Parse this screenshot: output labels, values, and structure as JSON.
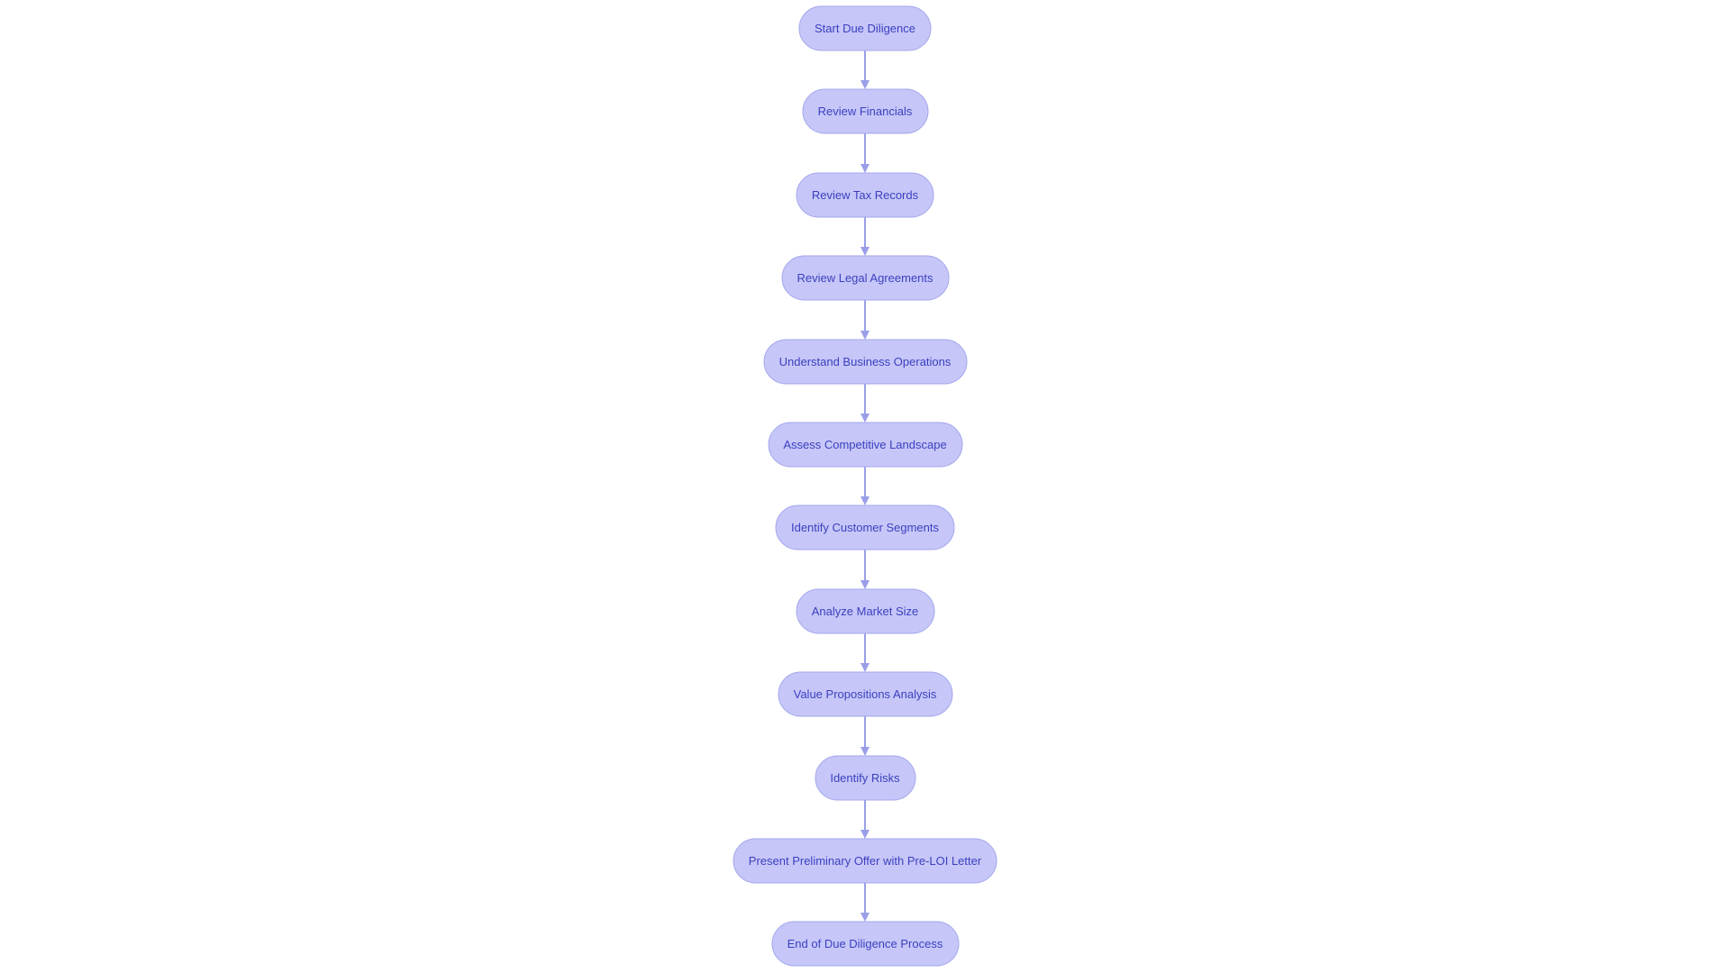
{
  "diagram": {
    "type": "flowchart",
    "direction": "top-to-bottom",
    "colors": {
      "node_fill": "#c6c7f8",
      "node_stroke": "#a3a6ec",
      "node_text": "#3c3fbf",
      "edge": "#9a9ee8",
      "background": "#ffffff"
    },
    "nodes": [
      {
        "id": "start",
        "label": "Start Due Diligence",
        "shape": "stadium"
      },
      {
        "id": "financials",
        "label": "Review Financials",
        "shape": "stadium"
      },
      {
        "id": "tax",
        "label": "Review Tax Records",
        "shape": "stadium"
      },
      {
        "id": "legal",
        "label": "Review Legal Agreements",
        "shape": "stadium"
      },
      {
        "id": "operations",
        "label": "Understand Business Operations",
        "shape": "stadium"
      },
      {
        "id": "competitive",
        "label": "Assess Competitive Landscape",
        "shape": "stadium"
      },
      {
        "id": "segments",
        "label": "Identify Customer Segments",
        "shape": "stadium"
      },
      {
        "id": "market",
        "label": "Analyze Market Size",
        "shape": "stadium"
      },
      {
        "id": "value",
        "label": "Value Propositions Analysis",
        "shape": "stadium"
      },
      {
        "id": "risks",
        "label": "Identify Risks",
        "shape": "stadium"
      },
      {
        "id": "offer",
        "label": "Present Preliminary Offer with Pre-LOI Letter",
        "shape": "stadium"
      },
      {
        "id": "end",
        "label": "End of Due Diligence Process",
        "shape": "stadium"
      }
    ],
    "edges": [
      {
        "from": "start",
        "to": "financials"
      },
      {
        "from": "financials",
        "to": "tax"
      },
      {
        "from": "tax",
        "to": "legal"
      },
      {
        "from": "legal",
        "to": "operations"
      },
      {
        "from": "operations",
        "to": "competitive"
      },
      {
        "from": "competitive",
        "to": "segments"
      },
      {
        "from": "segments",
        "to": "market"
      },
      {
        "from": "market",
        "to": "value"
      },
      {
        "from": "value",
        "to": "risks"
      },
      {
        "from": "risks",
        "to": "offer"
      },
      {
        "from": "offer",
        "to": "end"
      }
    ]
  }
}
